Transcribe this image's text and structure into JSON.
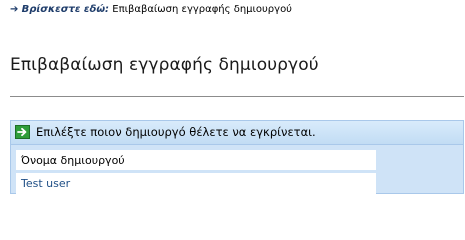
{
  "breadcrumb": {
    "arrow": "➔",
    "prefix": "Βρίσκεστε εδώ:",
    "current": "Επιβαβαίωση εγγραφής δημιουργού"
  },
  "page_title": "Επιβαβαίωση εγγραφής δημιουργού",
  "panel": {
    "header_icon": "arrow-right-icon",
    "header_text": "Επιλέξτε ποιον δημιουργό θέλετε να εγκρίνεται.",
    "table": {
      "columns": [
        "Όνομα δημιουργού"
      ],
      "rows": [
        "Test user"
      ]
    }
  },
  "colors": {
    "panel_bg": "#cfe3f7",
    "panel_border": "#a9c8ea",
    "link": "#1f4f86",
    "icon_green": "#2e9d3a"
  }
}
